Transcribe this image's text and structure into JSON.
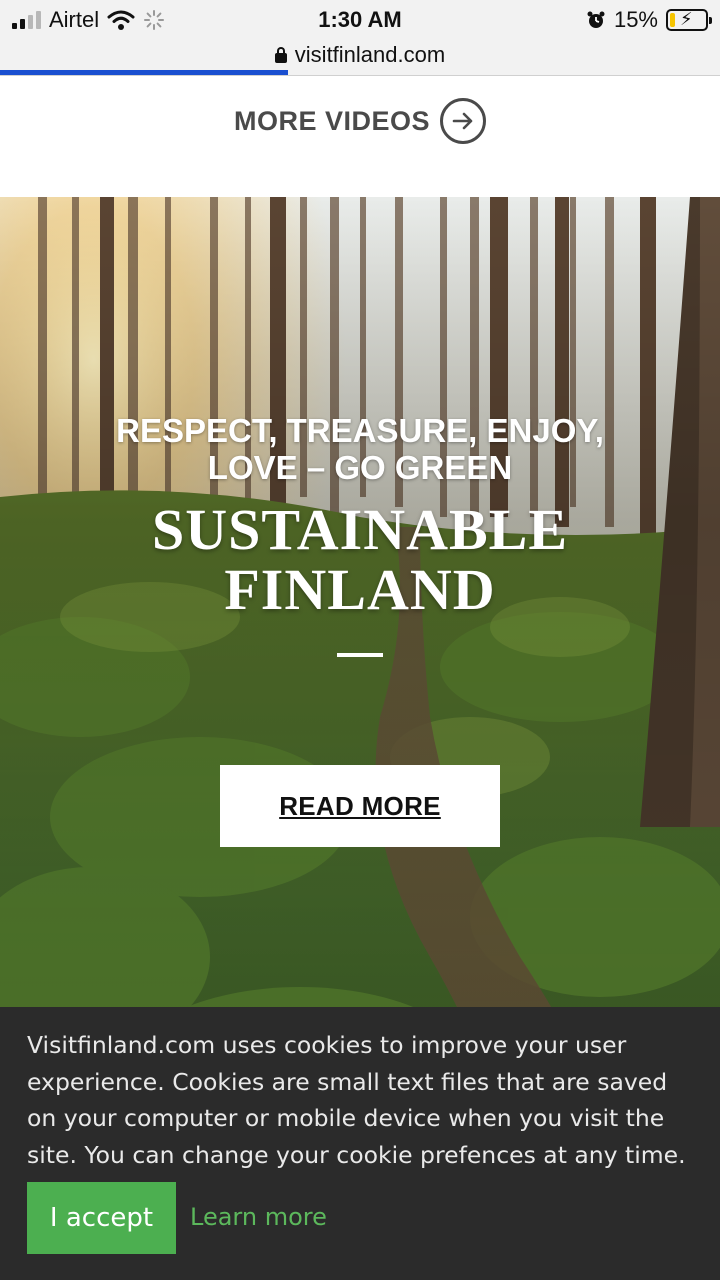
{
  "status_bar": {
    "carrier": "Airtel",
    "time": "1:30 AM",
    "battery": "15%",
    "battery_level": 0.15,
    "signal_bars": 2,
    "icons": [
      "signal-icon",
      "wifi-icon",
      "loading-spinner-icon",
      "alarm-icon",
      "battery-icon"
    ]
  },
  "browser": {
    "url": "visitfinland.com",
    "load_progress": 0.4
  },
  "videos": {
    "more_label": "MORE VIDEOS"
  },
  "hero": {
    "eyebrow": "RESPECT, TREASURE, ENJOY, LOVE – GO GREEN",
    "title": "SUSTAINABLE FINLAND",
    "cta_label": "READ MORE"
  },
  "cookie_banner": {
    "text": "Visitfinland.com uses cookies to improve your user experience. Cookies are small text files that are saved on your computer or mobile device when you visit the site. You can change your cookie prefences at any time.",
    "accept_label": "I accept",
    "learn_more_label": "Learn more"
  },
  "colors": {
    "accent_green": "#4caf50",
    "link_green": "#5cb85c",
    "progress_blue": "#1a4fd0",
    "banner_bg": "#2b2b2b"
  }
}
